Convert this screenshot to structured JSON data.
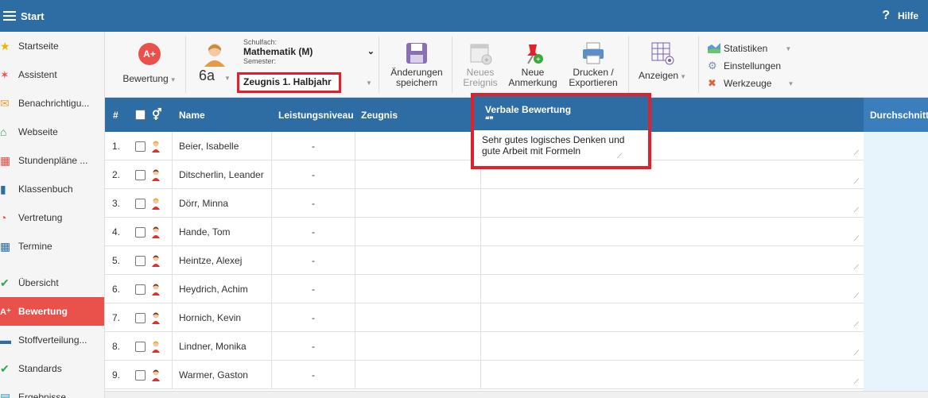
{
  "topbar": {
    "title": "Start",
    "help_label": "Hilfe",
    "help_icon": "?"
  },
  "sidebar": {
    "items": [
      {
        "label": "Startseite",
        "icon": "star-icon",
        "glyph": "★",
        "color": "#f0b400"
      },
      {
        "label": "Assistent",
        "icon": "wand-icon",
        "glyph": "✶",
        "color": "#e9524a"
      },
      {
        "label": "Benachrichtigu...",
        "icon": "envelope-icon",
        "glyph": "✉",
        "color": "#f0a030"
      },
      {
        "label": "Webseite",
        "icon": "house-icon",
        "glyph": "⌂",
        "color": "#2a9d5c"
      },
      {
        "label": "Stundenpläne ...",
        "icon": "timetable-icon",
        "glyph": "▦",
        "color": "#e9524a"
      },
      {
        "label": "Klassenbuch",
        "icon": "book-icon",
        "glyph": "▮",
        "color": "#2e6da4"
      },
      {
        "label": "Vertretung",
        "icon": "substitution-icon",
        "glyph": "◔",
        "color": "#e9524a"
      },
      {
        "label": "Termine",
        "icon": "calendar-icon",
        "glyph": "▦",
        "color": "#2e6da4"
      },
      {
        "label": "Übersicht",
        "icon": "check-circle-icon",
        "glyph": "✔",
        "color": "#2aa84a"
      },
      {
        "label": "Bewertung",
        "icon": "grade-icon",
        "glyph": "A⁺",
        "color": "#ffffff",
        "active": true
      },
      {
        "label": "Stoffverteilung...",
        "icon": "briefcase-icon",
        "glyph": "▬",
        "color": "#2e6da4"
      },
      {
        "label": "Standards",
        "icon": "shield-check-icon",
        "glyph": "✔",
        "color": "#2aa84a"
      },
      {
        "label": "Ergebnisse",
        "icon": "results-icon",
        "glyph": "▤",
        "color": "#2aa0c0"
      }
    ]
  },
  "toolbar": {
    "bewertung_label": "Bewertung",
    "grade_badge": "A+",
    "class_label": "6a",
    "schulfach_label": "Schulfach:",
    "schulfach_value": "Mathematik (M)",
    "semester_label": "Semester:",
    "semester_value": "Zeugnis 1. Halbjahr",
    "save_label_1": "Änderungen",
    "save_label_2": "speichern",
    "event_label_1": "Neues",
    "event_label_2": "Ereignis",
    "note_label_1": "Neue",
    "note_label_2": "Anmerkung",
    "print_label_1": "Drucken /",
    "print_label_2": "Exportieren",
    "show_label": "Anzeigen",
    "menu": {
      "statistiken": "Statistiken",
      "einstellungen": "Einstellungen",
      "werkzeuge": "Werkzeuge"
    }
  },
  "table": {
    "headers": {
      "num": "#",
      "name": "Name",
      "level": "Leistungsniveau",
      "zeugnis": "Zeugnis",
      "verbal": "Verbale Bewertung",
      "verbal_quote": "❝❞",
      "average": "Durchschnitt"
    },
    "rows": [
      {
        "num": "1.",
        "name": "Beier, Isabelle",
        "level": "-",
        "gender": "female"
      },
      {
        "num": "2.",
        "name": "Ditscherlin, Leander",
        "level": "-",
        "gender": "male"
      },
      {
        "num": "3.",
        "name": "Dörr, Minna",
        "level": "-",
        "gender": "female"
      },
      {
        "num": "4.",
        "name": "Hande, Tom",
        "level": "-",
        "gender": "male"
      },
      {
        "num": "5.",
        "name": "Heintze, Alexej",
        "level": "-",
        "gender": "male"
      },
      {
        "num": "6.",
        "name": "Heydrich, Achim",
        "level": "-",
        "gender": "male"
      },
      {
        "num": "7.",
        "name": "Hornich, Kevin",
        "level": "-",
        "gender": "male"
      },
      {
        "num": "8.",
        "name": "Lindner, Monika",
        "level": "-",
        "gender": "female"
      },
      {
        "num": "9.",
        "name": "Warmer, Gaston",
        "level": "-",
        "gender": "male"
      }
    ],
    "verbal_text_row1": "Sehr gutes logisches Denken und gute Arbeit mit Formeln"
  },
  "colors": {
    "primary": "#2e6da4",
    "active": "#e9524a",
    "highlight": "#e0202a",
    "avg_col": "#e8f4fb"
  }
}
